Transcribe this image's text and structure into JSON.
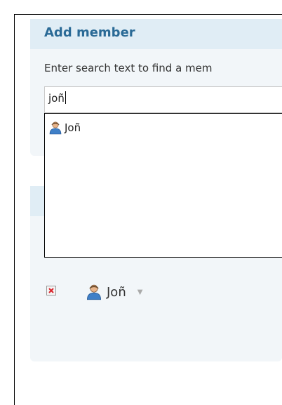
{
  "dialog": {
    "title": "Add member",
    "prompt": "Enter search text to find a mem",
    "search": {
      "value": "joñ"
    },
    "results": [
      {
        "name": "Joñ",
        "icon": "user-icon"
      }
    ]
  },
  "selected": {
    "remove_icon": "remove-icon",
    "member": {
      "name": "Joñ",
      "icon": "user-icon",
      "menu_icon": "chevron-down-icon"
    }
  },
  "colors": {
    "title": "#2a6a96",
    "panel_bg": "#f2f6f9",
    "header_bg": "#e0edf5"
  }
}
